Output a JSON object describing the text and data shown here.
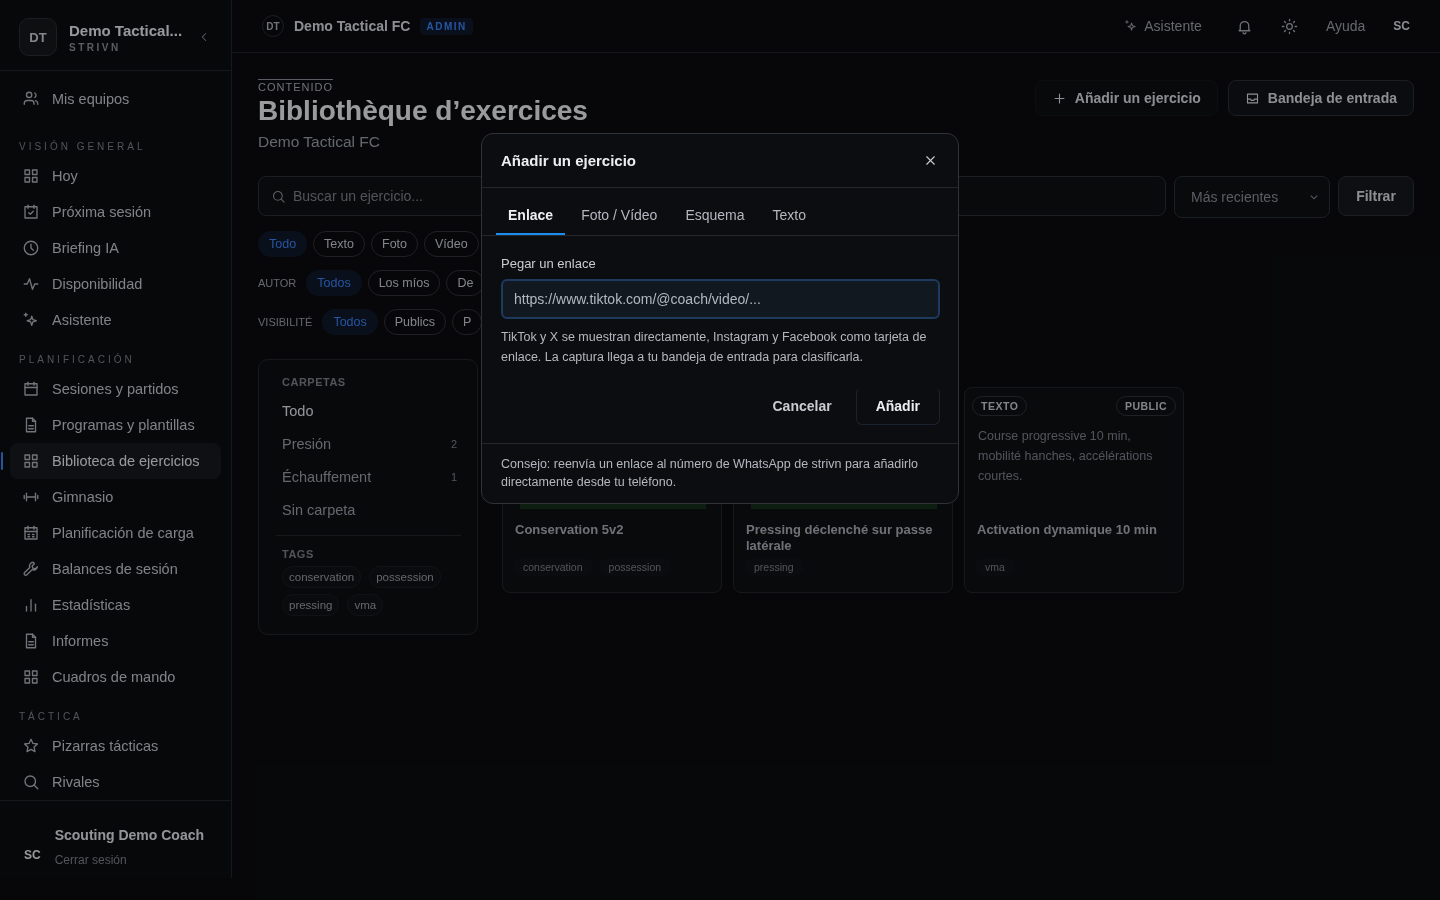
{
  "sidebar": {
    "team": {
      "initials": "DT",
      "name": "Demo Tactical...",
      "org": "STRIVN"
    },
    "top_item": {
      "label": "Mis equipos"
    },
    "sections": [
      {
        "title": "VISIÓN GENERAL",
        "items": [
          {
            "label": "Hoy",
            "selected": false
          },
          {
            "label": "Próxima sesión",
            "selected": false
          },
          {
            "label": "Briefing IA",
            "selected": false
          },
          {
            "label": "Disponibilidad",
            "selected": false
          },
          {
            "label": "Asistente",
            "selected": false
          }
        ]
      },
      {
        "title": "PLANIFICACIÓN",
        "items": [
          {
            "label": "Sesiones y partidos",
            "selected": false
          },
          {
            "label": "Programas y plantillas",
            "selected": false
          },
          {
            "label": "Biblioteca de ejercicios",
            "selected": true
          },
          {
            "label": "Gimnasio",
            "selected": false
          },
          {
            "label": "Planificación de carga",
            "selected": false
          },
          {
            "label": "Balances de sesión",
            "selected": false
          },
          {
            "label": "Estadísticas",
            "selected": false
          },
          {
            "label": "Informes",
            "selected": false
          },
          {
            "label": "Cuadros de mando",
            "selected": false
          }
        ]
      },
      {
        "title": "TÁCTICA",
        "items": [
          {
            "label": "Pizarras tácticas",
            "selected": false
          },
          {
            "label": "Rivales",
            "selected": false
          }
        ]
      }
    ],
    "user": {
      "initials": "SC",
      "name": "Scouting Demo Coach",
      "logout": "Cerrar sesión"
    }
  },
  "topbar": {
    "team_initials": "DT",
    "team_name": "Demo Tactical FC",
    "role": "ADMIN",
    "assistant": "Asistente",
    "help": "Ayuda",
    "user_initials": "SC"
  },
  "page": {
    "eyebrow": "CONTENIDO",
    "title": "Bibliothèque d’exercices",
    "subtitle": "Demo Tactical FC",
    "actions": [
      {
        "label": "Añadir un ejercicio",
        "kind": "ghost"
      },
      {
        "label": "Bandeja de entrada",
        "kind": "outline"
      }
    ]
  },
  "toolbar": {
    "search_placeholder": "Buscar un ejercicio...",
    "sort": "Más recientes",
    "filter": "Filtrar"
  },
  "filters": [
    {
      "chips": [
        {
          "label": "Todo",
          "selected": true
        },
        {
          "label": "Texto",
          "selected": false
        },
        {
          "label": "Foto",
          "selected": false
        },
        {
          "label": "Vídeo",
          "selected": false
        }
      ]
    },
    {
      "label": "AUTOR",
      "chips": [
        {
          "label": "Todos",
          "selected": true
        },
        {
          "label": "Los míos",
          "selected": false
        },
        {
          "label": "De",
          "selected": false
        }
      ]
    },
    {
      "label": "VISIBILITÉ",
      "chips": [
        {
          "label": "Todos",
          "selected": true
        },
        {
          "label": "Publics",
          "selected": false
        },
        {
          "label": "P",
          "selected": false
        }
      ]
    }
  ],
  "folders": {
    "title": "CARPETAS",
    "items": [
      {
        "label": "Todo",
        "selected": true
      },
      {
        "label": "Presión",
        "count": "2",
        "selected": false
      },
      {
        "label": "Échauffement",
        "count": "1",
        "selected": false
      },
      {
        "label": "Sin carpeta",
        "selected": false
      }
    ],
    "tags_title": "TAGS",
    "tags": [
      "conservation",
      "possession",
      "pressing",
      "vma"
    ]
  },
  "cards": [
    {
      "kind": "picture",
      "title": "Conservation 5v2",
      "tags": [
        "conservation",
        "possession"
      ]
    },
    {
      "kind": "picture",
      "title": "Pressing déclenché sur passe latérale",
      "tags": [
        "pressing"
      ]
    },
    {
      "kind": "text",
      "type": "TEXTO",
      "visibility": "PUBLIC",
      "excerpt": "Course progressive 10 min, mobilité hanches, accélérations courtes.",
      "title": "Activation dynamique 10 min",
      "tags": [
        "vma"
      ]
    }
  ],
  "dialog": {
    "title": "Añadir un ejercicio",
    "tabs": [
      {
        "label": "Enlace",
        "selected": true
      },
      {
        "label": "Foto / Vídeo",
        "selected": false
      },
      {
        "label": "Esquema",
        "selected": false
      },
      {
        "label": "Texto",
        "selected": false
      }
    ],
    "field_label": "Pegar un enlace",
    "placeholder": "https://www.tiktok.com/@coach/video/...",
    "help": "TikTok y X se muestran directamente, Instagram y Facebook como tarjeta de enlace. La captura llega a tu bandeja de entrada para clasificarla.",
    "cancel": "Cancelar",
    "submit": "Añadir",
    "tip": "Consejo: reenvía un enlace al número de WhatsApp de strivn para añadirlo directamente desde tu teléfono."
  }
}
